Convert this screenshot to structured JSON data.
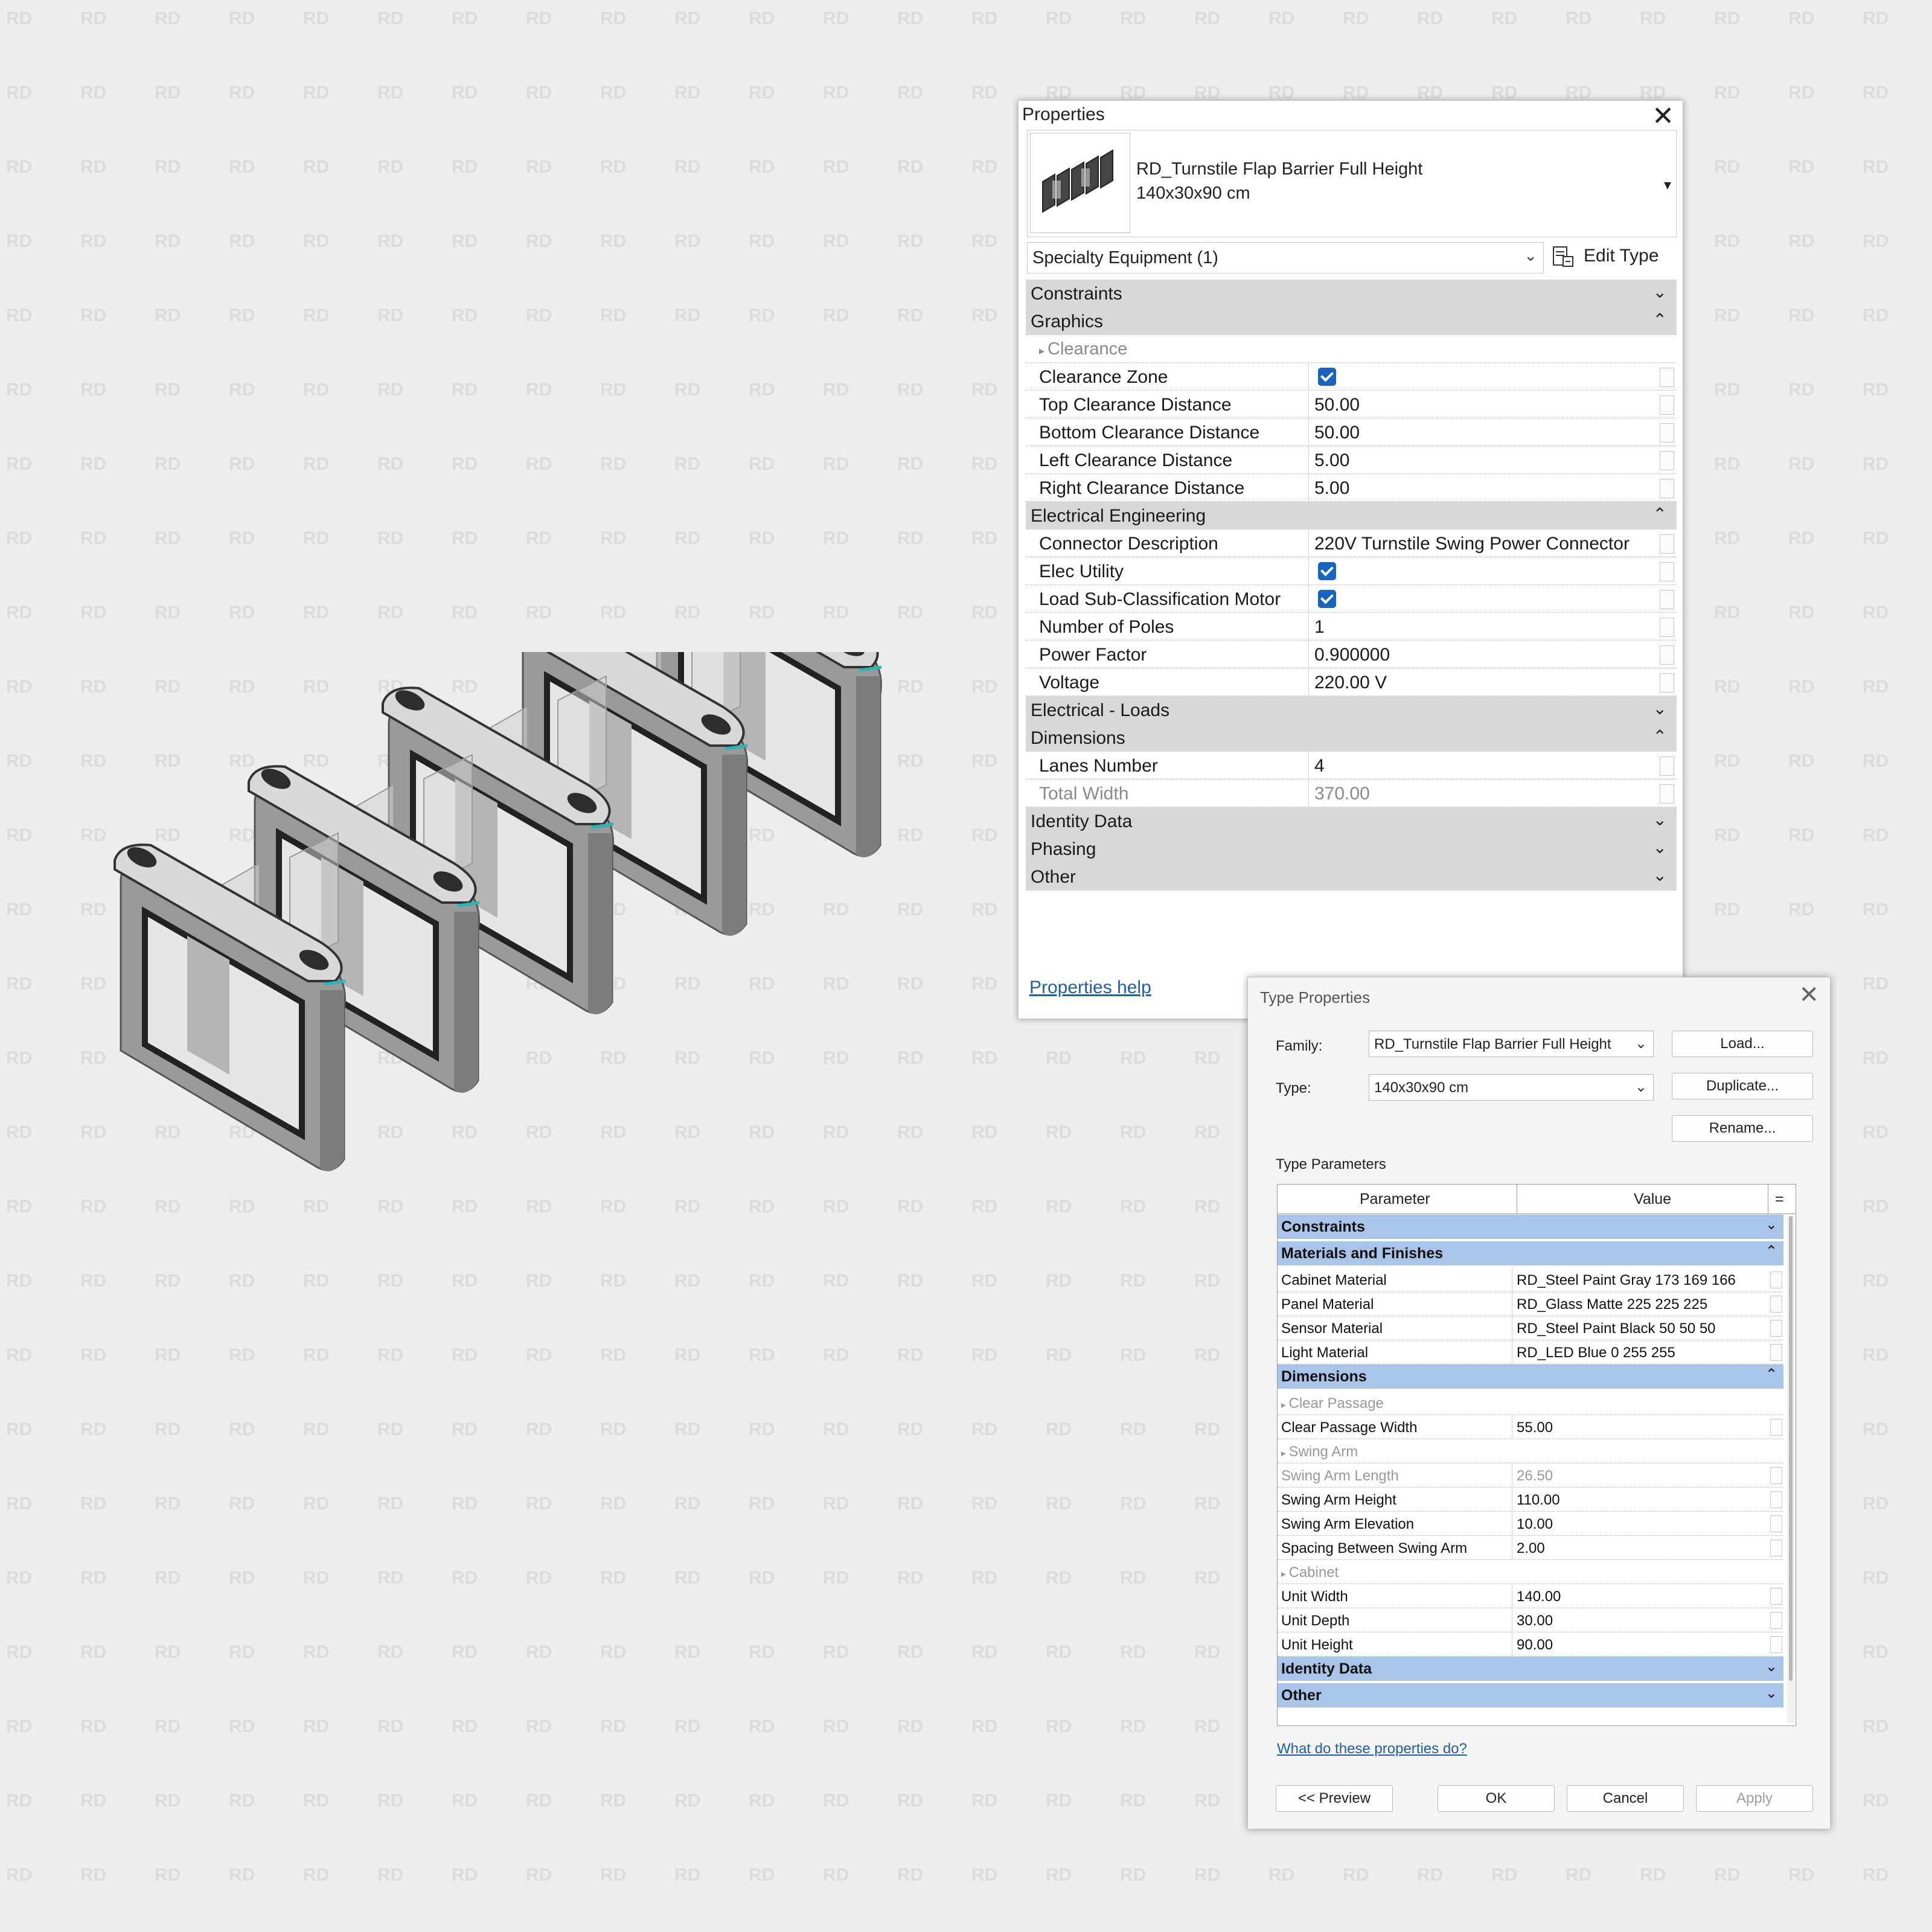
{
  "watermark_text": "RD",
  "properties": {
    "title": "Properties",
    "close_glyph": "✕",
    "family_name": "RD_Turnstile Flap Barrier Full Height",
    "family_type": "140x30x90 cm",
    "instance_selector": "Specialty Equipment (1)",
    "edit_type_label": "Edit Type",
    "help_link": "Properties help",
    "groups": [
      {
        "label": "Constraints",
        "collapsed": true,
        "rows": []
      },
      {
        "label": "Graphics",
        "collapsed": false,
        "rows": [
          {
            "name": "Clearance",
            "subgroup": true
          },
          {
            "name": "Clearance Zone",
            "checkbox": true
          },
          {
            "name": "Top Clearance Distance",
            "value": "50.00"
          },
          {
            "name": "Bottom Clearance Distance",
            "value": "50.00"
          },
          {
            "name": "Left Clearance Distance",
            "value": "5.00"
          },
          {
            "name": "Right Clearance Distance",
            "value": "5.00"
          }
        ]
      },
      {
        "label": "Electrical Engineering",
        "collapsed": false,
        "rows": [
          {
            "name": "Connector Description",
            "value": "220V Turnstile Swing Power Connector"
          },
          {
            "name": "Elec Utility",
            "checkbox": true
          },
          {
            "name": "Load Sub-Classification Motor",
            "checkbox": true
          },
          {
            "name": "Number of Poles",
            "value": "1"
          },
          {
            "name": "Power Factor",
            "value": "0.900000"
          },
          {
            "name": "Voltage",
            "value": "220.00 V"
          }
        ]
      },
      {
        "label": "Electrical - Loads",
        "collapsed": true,
        "rows": []
      },
      {
        "label": "Dimensions",
        "collapsed": false,
        "rows": [
          {
            "name": "Lanes Number",
            "value": "4"
          },
          {
            "name": "Total Width",
            "value": "370.00",
            "readonly": true
          }
        ]
      },
      {
        "label": "Identity Data",
        "collapsed": true,
        "rows": []
      },
      {
        "label": "Phasing",
        "collapsed": true,
        "rows": []
      },
      {
        "label": "Other",
        "collapsed": true,
        "rows": []
      }
    ]
  },
  "type_properties": {
    "title": "Type Properties",
    "close_glyph": "✕",
    "family_label": "Family:",
    "family_value": "RD_Turnstile Flap Barrier Full Height",
    "type_label": "Type:",
    "type_value": "140x30x90 cm",
    "load_button": "Load...",
    "duplicate_button": "Duplicate...",
    "rename_button": "Rename...",
    "section_label": "Type Parameters",
    "col_parameter": "Parameter",
    "col_value": "Value",
    "col_eq": "=",
    "groups": [
      {
        "label": "Constraints",
        "collapsed": true,
        "rows": []
      },
      {
        "label": "Materials and Finishes",
        "collapsed": false,
        "rows": [
          {
            "name": "Cabinet Material",
            "value": "RD_Steel Paint Gray 173 169 166"
          },
          {
            "name": "Panel Material",
            "value": "RD_Glass Matte 225 225 225"
          },
          {
            "name": "Sensor Material",
            "value": "RD_Steel Paint Black 50 50 50"
          },
          {
            "name": "Light Material",
            "value": "RD_LED Blue 0 255 255"
          }
        ]
      },
      {
        "label": "Dimensions",
        "collapsed": false,
        "rows": [
          {
            "name": "Clear Passage",
            "subgroup": true
          },
          {
            "name": "Clear Passage Width",
            "value": "55.00"
          },
          {
            "name": "Swing Arm",
            "subgroup": true
          },
          {
            "name": "Swing Arm Length",
            "value": "26.50",
            "readonly": true
          },
          {
            "name": "Swing Arm Height",
            "value": "110.00"
          },
          {
            "name": "Swing Arm Elevation",
            "value": "10.00"
          },
          {
            "name": "Spacing Between Swing Arm",
            "value": "2.00"
          },
          {
            "name": "Cabinet",
            "subgroup": true
          },
          {
            "name": "Unit Width",
            "value": "140.00"
          },
          {
            "name": "Unit Depth",
            "value": "30.00"
          },
          {
            "name": "Unit Height",
            "value": "90.00"
          }
        ]
      },
      {
        "label": "Identity Data",
        "collapsed": true,
        "rows": []
      },
      {
        "label": "Other",
        "collapsed": true,
        "rows": []
      }
    ],
    "help_link": "What do these properties do?",
    "preview_button": "<< Preview",
    "ok_button": "OK",
    "cancel_button": "Cancel",
    "apply_button": "Apply"
  }
}
